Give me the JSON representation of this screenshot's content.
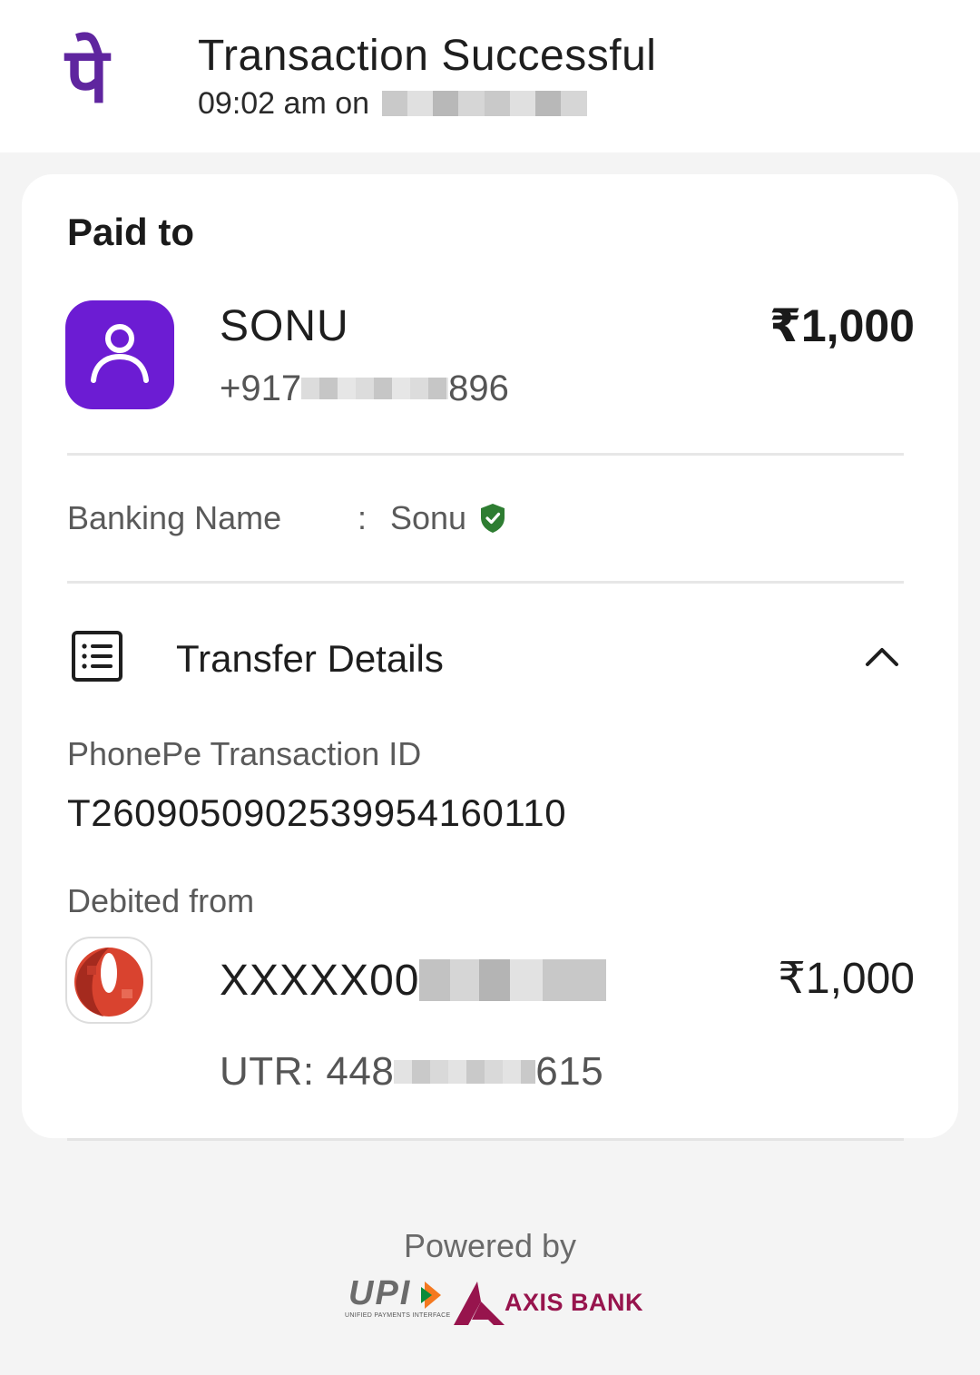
{
  "header": {
    "brand_icon": "phonepe-logo-icon",
    "brand_glyph": "पे",
    "title": "Transaction Successful",
    "time": "09:02 am on"
  },
  "payment": {
    "section_heading": "Paid to",
    "payee_name": "SONU",
    "payee_phone_prefix": "+917",
    "payee_phone_suffix": "896",
    "amount": "₹1,000",
    "avatar_icon": "person-avatar-icon",
    "avatar_color": "#6c1cd3"
  },
  "banking_name": {
    "label": "Banking Name",
    "separator": ":",
    "value": "Sonu",
    "verified_icon": "verified-shield-icon",
    "verified_color": "#2e7d32"
  },
  "transfer_details": {
    "label": "Transfer Details",
    "icon": "receipt-list-icon",
    "toggle_icon": "chevron-up-icon",
    "txn_id_label": "PhonePe Transaction ID",
    "txn_id": "T2609050902539954160110",
    "debited_label": "Debited from",
    "account_prefix": "XXXXX00",
    "debit_amount": "₹1,000",
    "utr_prefix": "UTR: 448",
    "utr_suffix": "615",
    "bank_icon": "bank-logo-icon"
  },
  "footer": {
    "powered_by": "Powered by",
    "upi_text": "UPI",
    "upi_subtext": "UNIFIED PAYMENTS INTERFACE",
    "bank_text": "AXIS BANK",
    "bank_color": "#97144d"
  }
}
